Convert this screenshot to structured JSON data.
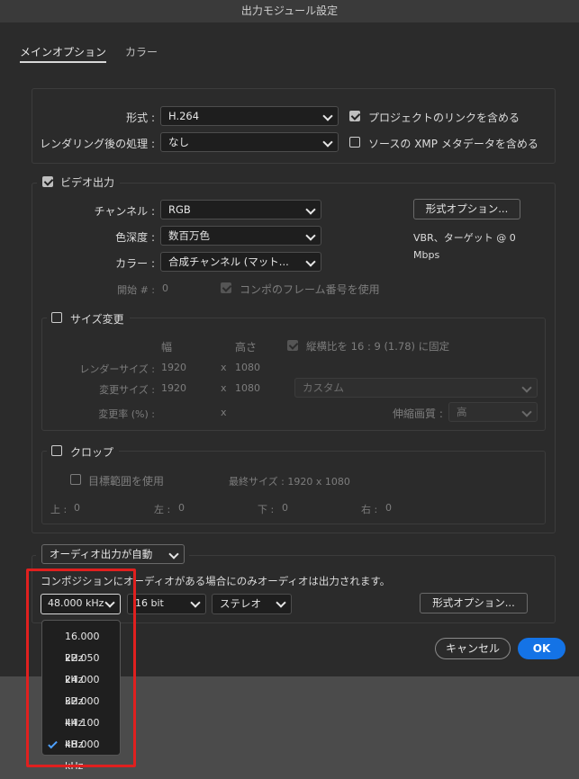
{
  "window": {
    "title": "出力モジュール設定"
  },
  "tabs": [
    {
      "label": "メインオプション",
      "active": true
    },
    {
      "label": "カラー",
      "active": false
    }
  ],
  "format": {
    "format_label": "形式 :",
    "format_value": "H.264",
    "post_render_label": "レンダリング後の処理 :",
    "post_render_value": "なし",
    "include_project_link_label": "プロジェクトのリンクを含める",
    "include_project_link_checked": true,
    "include_xmp_label": "ソースの XMP メタデータを含める",
    "include_xmp_checked": false
  },
  "video": {
    "section_label": "ビデオ出力",
    "checked": true,
    "channels_label": "チャンネル :",
    "channels_value": "RGB",
    "depth_label": "色深度 :",
    "depth_value": "数百万色",
    "color_label": "カラー :",
    "color_value": "合成チャンネル (マット...",
    "start_label": "開始 # :",
    "start_value": "0",
    "use_comp_frame_label": "コンポのフレーム番号を使用",
    "use_comp_frame_checked": true,
    "format_options_button": "形式オプション...",
    "format_info_line1": "VBR、ターゲット @ 0",
    "format_info_line2": "Mbps"
  },
  "resize": {
    "section_label": "サイズ変更",
    "checked": false,
    "width_header": "幅",
    "height_header": "高さ",
    "lock_aspect_label": "縦横比を 16 : 9 (1.78) に固定",
    "lock_aspect_checked": true,
    "render_size_label": "レンダーサイズ :",
    "render_w": "1920",
    "render_h": "1080",
    "resize_to_label": "変更サイズ :",
    "resize_w": "1920",
    "resize_h": "1080",
    "times": "x",
    "preset_value": "カスタム",
    "resize_pct_label": "変更率 (%) :",
    "quality_label": "伸縮画質 :",
    "quality_value": "高"
  },
  "crop": {
    "section_label": "クロップ",
    "checked": false,
    "use_roi_label": "目標範囲を使用",
    "use_roi_checked": false,
    "final_size_label": "最終サイズ : 1920 x 1080",
    "top_label": "上 :",
    "top_value": "0",
    "left_label": "左 :",
    "left_value": "0",
    "bottom_label": "下 :",
    "bottom_value": "0",
    "right_label": "右 :",
    "right_value": "0"
  },
  "audio": {
    "mode_value": "オーディオ出力が自動",
    "note": "コンポジションにオーディオがある場合にのみオーディオは出力されます。",
    "sample_rate_value": "48.000 kHz",
    "bit_depth_value": "16 bit",
    "channels_value": "ステレオ",
    "format_options_button": "形式オプション..."
  },
  "sample_rate_menu": {
    "items": [
      "16.000 kHz",
      "22.050 kHz",
      "24.000 kHz",
      "32.000 kHz",
      "44.100 kHz",
      "48.000 kHz"
    ],
    "selected": "48.000 kHz"
  },
  "footer": {
    "cancel_label": "キャンセル",
    "ok_label": "OK"
  },
  "colors": {
    "accent": "#1473e6",
    "highlight_box": "#e0201f",
    "dialog_bg": "#2b2b2b"
  }
}
